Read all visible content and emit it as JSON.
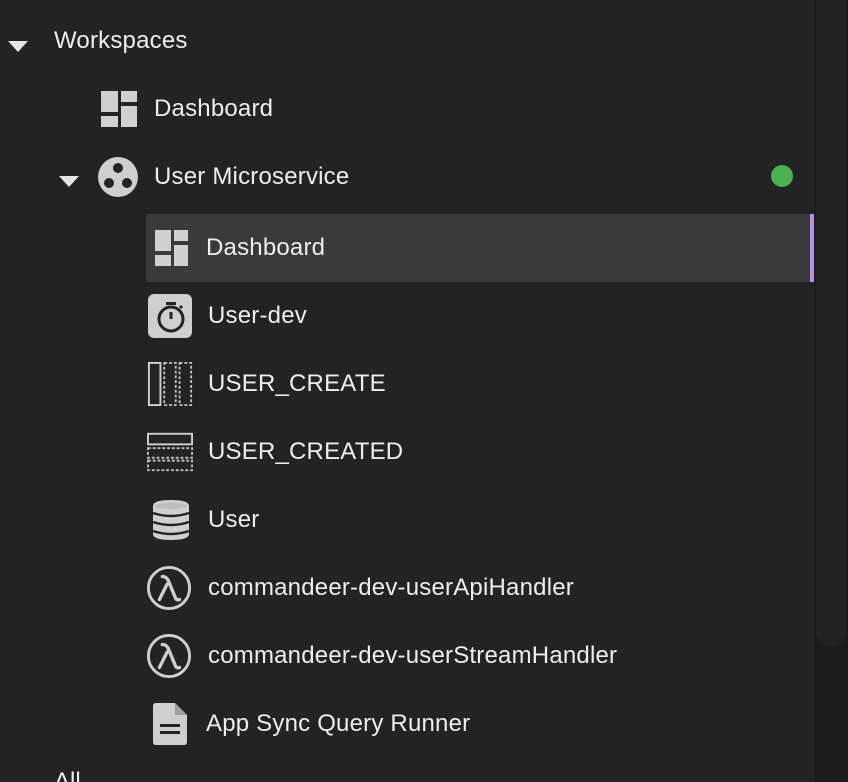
{
  "tree": {
    "workspaces": {
      "label": "Workspaces"
    },
    "dashboard": {
      "label": "Dashboard",
      "icon": "dashboard-icon"
    },
    "microservice": {
      "label": "User Microservice",
      "icon": "microservice-icon",
      "status_color": "#4caf50",
      "children": [
        {
          "label": "Dashboard",
          "icon": "dashboard-icon"
        },
        {
          "label": "User-dev",
          "icon": "stopwatch-icon"
        },
        {
          "label": "USER_CREATE",
          "icon": "stream-icon"
        },
        {
          "label": "USER_CREATED",
          "icon": "queue-icon"
        },
        {
          "label": "User",
          "icon": "database-icon"
        },
        {
          "label": "commandeer-dev-userApiHandler",
          "icon": "lambda-icon"
        },
        {
          "label": "commandeer-dev-userStreamHandler",
          "icon": "lambda-icon"
        },
        {
          "label": "App Sync Query Runner",
          "icon": "document-icon"
        }
      ]
    },
    "all": {
      "label": "All"
    }
  },
  "colors": {
    "background": "#232323",
    "selected_row": "#3a3a3a",
    "selected_accent": "#b68ee6"
  }
}
